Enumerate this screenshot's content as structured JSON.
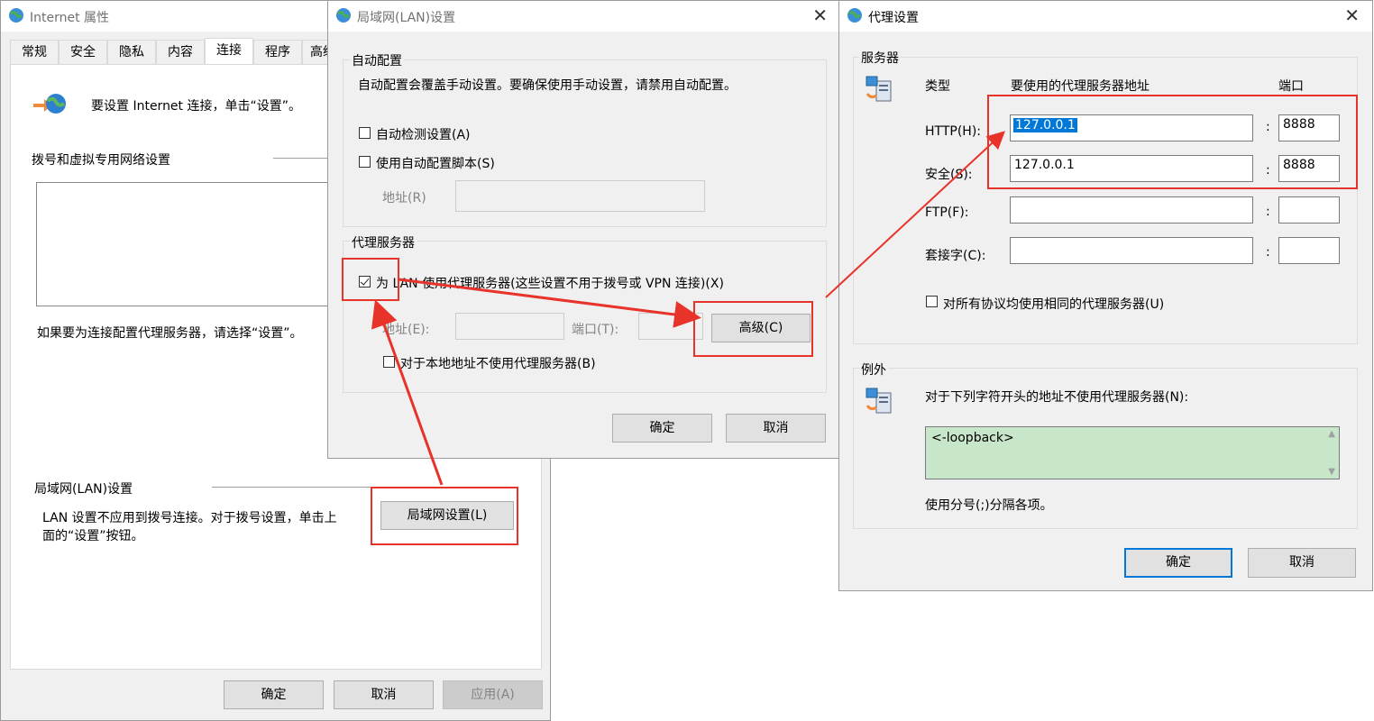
{
  "internet_props": {
    "title": "Internet 属性",
    "tabs": [
      "常规",
      "安全",
      "隐私",
      "内容",
      "连接",
      "程序",
      "高级"
    ],
    "active_tab": "连接",
    "setup_text": "要设置 Internet 连接，单击“设置”。",
    "dialup_section": "拨号和虚拟专用网络设置",
    "proxy_hint": "如果要为连接配置代理服务器，请选择“设置”。",
    "lan_section": "局域网(LAN)设置",
    "lan_text_line1": "LAN 设置不应用到拨号连接。对于拨号设置，单击上",
    "lan_text_line2": "面的“设置”按钮。",
    "lan_button": "局域网设置(L)",
    "ok": "确定",
    "cancel": "取消",
    "apply": "应用(A)"
  },
  "lan_dialog": {
    "title": "局域网(LAN)设置",
    "auto_group": "自动配置",
    "auto_desc": "自动配置会覆盖手动设置。要确保使用手动设置，请禁用自动配置。",
    "auto_detect": "自动检测设置(A)",
    "auto_script": "使用自动配置脚本(S)",
    "address_label": "地址(R)",
    "proxy_group": "代理服务器",
    "use_proxy": "为 LAN 使用代理服务器(这些设置不用于拨号或 VPN 连接)(X)",
    "proxy_address_label": "地址(E):",
    "port_label": "端口(T):",
    "advanced_button": "高级(C)",
    "bypass_local": "对于本地地址不使用代理服务器(B)",
    "ok": "确定",
    "cancel": "取消"
  },
  "proxy_dialog": {
    "title": "代理设置",
    "servers_group": "服务器",
    "col_type": "类型",
    "col_address": "要使用的代理服务器地址",
    "col_port": "端口",
    "rows": [
      {
        "label": "HTTP(H):",
        "address": "127.0.0.1",
        "port": "8888"
      },
      {
        "label": "安全(S):",
        "address": "127.0.0.1",
        "port": "8888"
      },
      {
        "label": "FTP(F):",
        "address": "",
        "port": ""
      },
      {
        "label": "套接字(C):",
        "address": "",
        "port": ""
      }
    ],
    "colon": ":",
    "same_proxy": "对所有协议均使用相同的代理服务器(U)",
    "exceptions_group": "例外",
    "exceptions_desc": "对于下列字符开头的地址不使用代理服务器(N):",
    "exceptions_value": "<-loopback>",
    "separator_hint": "使用分号(;)分隔各项。",
    "ok": "确定",
    "cancel": "取消"
  },
  "colors": {
    "annotation_red": "#e8332b",
    "selection_blue": "#0078d7",
    "highlight_green": "#c8e6c9"
  },
  "icons": [
    "globe-icon",
    "network-icon",
    "computers-icon",
    "close-icon",
    "checkbox-checked-icon",
    "scroll-up-icon",
    "scroll-down-icon"
  ]
}
